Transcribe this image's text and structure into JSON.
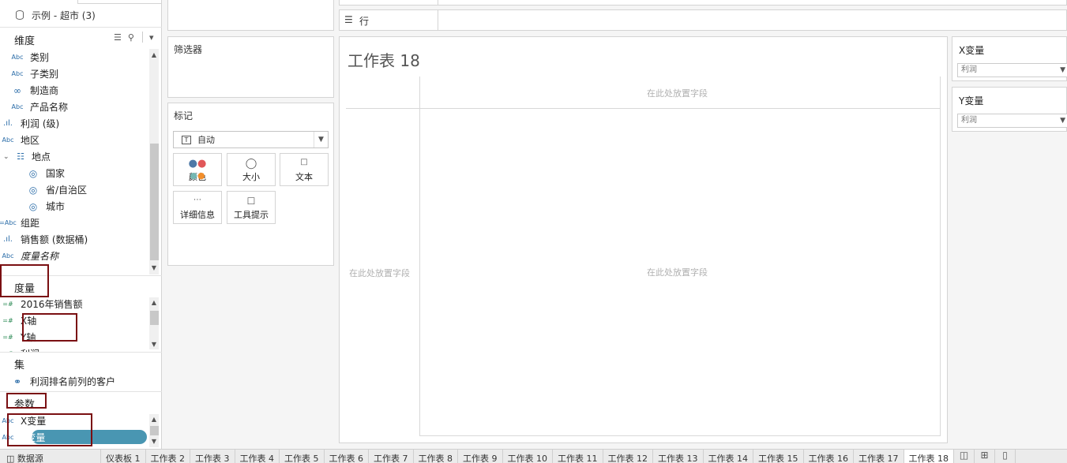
{
  "datasource": {
    "name": "示例 - 超市 (3)"
  },
  "dimensions": {
    "title": "维度",
    "fields": [
      {
        "type": "Abc",
        "label": "类别"
      },
      {
        "type": "Abc",
        "label": "子类别"
      },
      {
        "type": "link",
        "label": "制造商"
      },
      {
        "type": "Abc",
        "label": "产品名称"
      },
      {
        "type": "bin",
        "label": "利润 (级)"
      },
      {
        "type": "Abc",
        "label": "地区"
      },
      {
        "type": "hier",
        "label": "地点"
      },
      {
        "type": "geo",
        "label": "国家"
      },
      {
        "type": "geo",
        "label": "省/自治区"
      },
      {
        "type": "geo",
        "label": "城市"
      },
      {
        "type": "=Abc",
        "label": "组距"
      },
      {
        "type": "bin",
        "label": "销售额 (数据桶)"
      },
      {
        "type": "Abc",
        "label": "度量名称"
      }
    ]
  },
  "measures": {
    "title": "度量",
    "fields": [
      {
        "type": "=#",
        "label": "2016年销售额"
      },
      {
        "type": "=#",
        "label": "X轴"
      },
      {
        "type": "=#",
        "label": "Y轴"
      },
      {
        "type": "=#",
        "label": "利润"
      }
    ]
  },
  "sets": {
    "title": "集",
    "fields": [
      {
        "label": "利润排名前列的客户"
      }
    ]
  },
  "parameters": {
    "title": "参数",
    "fields": [
      {
        "type": "Abc",
        "label": "X变量"
      },
      {
        "type": "Abc",
        "label": "Y变量"
      }
    ]
  },
  "shelves": {
    "filters": "筛选器",
    "rows": "行"
  },
  "marks": {
    "title": "标记",
    "type": "自动",
    "buttons": [
      "颜色",
      "大小",
      "文本",
      "详细信息",
      "工具提示"
    ]
  },
  "worksheet": {
    "title": "工作表 18",
    "drop_hint": "在此处放置字段"
  },
  "param_cards": [
    {
      "title": "X变量",
      "value": "利润"
    },
    {
      "title": "Y变量",
      "value": "利润"
    }
  ],
  "tabs": [
    "数据源",
    "仪表板 1",
    "工作表 2",
    "工作表 3",
    "工作表 4",
    "工作表 5",
    "工作表 6",
    "工作表 7",
    "工作表 8",
    "工作表 9",
    "工作表 10",
    "工作表 11",
    "工作表 12",
    "工作表 13",
    "工作表 14",
    "工作表 15",
    "工作表 16",
    "工作表 17",
    "工作表 18"
  ],
  "colors": {
    "accent": "#4996b2",
    "highlight_box": "#7a0f12"
  }
}
